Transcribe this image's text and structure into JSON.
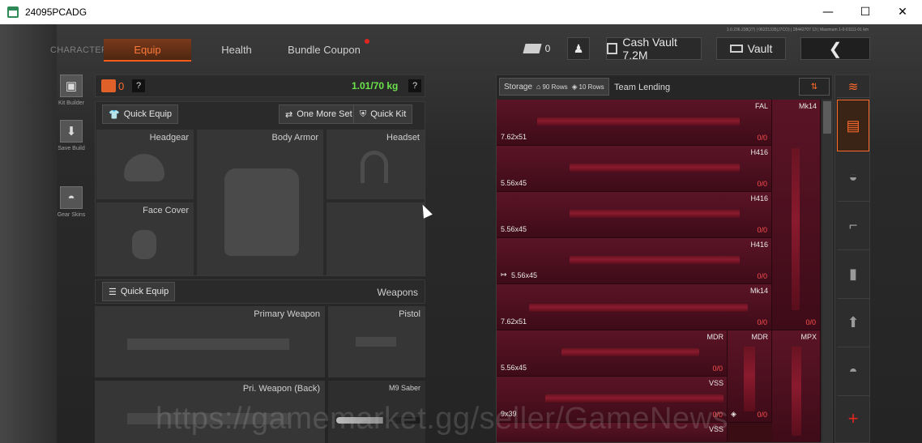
{
  "window": {
    "title": "24095PCADG",
    "minimize": "—",
    "maximize": "☐",
    "close": "✕"
  },
  "build_info": "1.0.236.238(27) | 06221335(J7CO) | 28442707 13 | Maximum 1-0-01111-01 km",
  "nav": {
    "character": "CHARACTER",
    "equip": "Equip",
    "health": "Health",
    "bundle": "Bundle Coupon"
  },
  "topbar": {
    "coupon_count": "0",
    "cash_vault": "Cash Vault 7.2M",
    "vault": "Vault",
    "back": "❮"
  },
  "left_rail": {
    "kit_builder": "Kit Builder",
    "save_build": "Save Build",
    "gear_skins": "Gear Skins"
  },
  "loadout": {
    "value": "0",
    "help": "?",
    "weight": "1.01/70 kg",
    "quick_equip": "Quick Equip",
    "one_more_set": "One More Set",
    "quick_kit": "Quick Kit",
    "slots": {
      "headgear": "Headgear",
      "body_armor": "Body Armor",
      "headset": "Headset",
      "face_cover": "Face Cover"
    },
    "weapons_title": "Weapons",
    "weapons_quick_equip": "Quick Equip",
    "weapon_slots": {
      "primary": "Primary Weapon",
      "pistol": "Pistol",
      "pri_back": "Pri. Weapon (Back)",
      "melee": "M9 Saber"
    }
  },
  "storage": {
    "tab_storage": "Storage",
    "rows_a": "90 Rows",
    "rows_b": "10 Rows",
    "tab_lending": "Team Lending",
    "items": [
      {
        "name": "FAL",
        "ammo": "7.62x51",
        "count": "0/0"
      },
      {
        "name": "H416",
        "ammo": "5.56x45",
        "count": "0/0"
      },
      {
        "name": "H416",
        "ammo": "5.56x45",
        "count": "0/0"
      },
      {
        "name": "H416",
        "ammo": "5.56x45",
        "count": "0/0"
      },
      {
        "name": "Mk14",
        "ammo": "7.62x51",
        "count": "0/0"
      },
      {
        "name": "MDR",
        "ammo": "5.56x45",
        "count": "0/0"
      },
      {
        "name": "VSS",
        "ammo": "9x39",
        "count": "0/0"
      },
      {
        "name": "VSS",
        "ammo": "",
        "count": ""
      }
    ],
    "side": [
      {
        "name": "Mk14",
        "count": "0/0"
      },
      {
        "name": "MDR",
        "count": "0/0"
      },
      {
        "name": "MPX",
        "count": ""
      }
    ]
  },
  "watermark": "https://gamemarket.gg/seller/GameNews",
  "colors": {
    "accent": "#ff5a1a",
    "weight": "#6be34a",
    "storage_bg": "#4a0f1e",
    "count_red": "#ff5050"
  }
}
